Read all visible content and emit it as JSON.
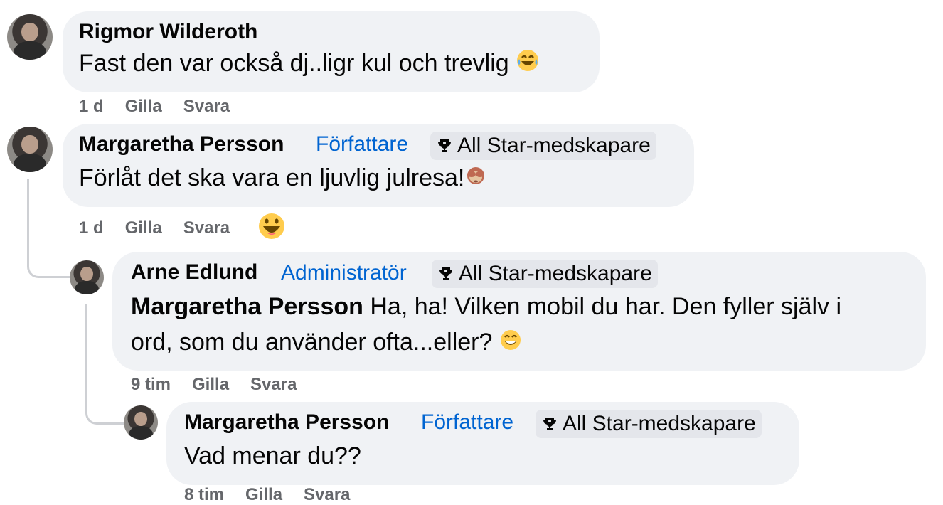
{
  "comments": [
    {
      "author": "Rigmor Wilderoth",
      "text": "Fast den var också dj..ligr kul och trevlig",
      "emoji": "laughing-tears-emoji",
      "time": "1 d",
      "like": "Gilla",
      "reply": "Svara"
    },
    {
      "author": "Margaretha Persson",
      "role": "Författare",
      "badge": "All Star-medskapare",
      "text": "Förlåt det ska vara en ljuvlig julresa!",
      "emoji": "see-no-evil-monkey-emoji",
      "time": "1 d",
      "like": "Gilla",
      "reply": "Svara",
      "reaction": "grinning-face-emoji"
    },
    {
      "author": "Arne Edlund",
      "role": "Administratör",
      "badge": "All Star-medskapare",
      "mention": "Margaretha Persson",
      "text_line1": "Ha, ha! Vilken mobil du har. Den fyller själv i",
      "text_line2": "ord, som du använder ofta...eller?",
      "emoji": "grinning-smile-emoji",
      "time": "9 tim",
      "like": "Gilla",
      "reply": "Svara"
    },
    {
      "author": "Margaretha Persson",
      "role": "Författare",
      "badge": "All Star-medskapare",
      "text": "Vad menar du??",
      "time": "8 tim",
      "like": "Gilla",
      "reply": "Svara"
    }
  ],
  "colors": {
    "bubble": "#f0f2f5",
    "role_link": "#0064d1",
    "meta_text": "#65676b",
    "thread_line": "#ced0d4"
  }
}
